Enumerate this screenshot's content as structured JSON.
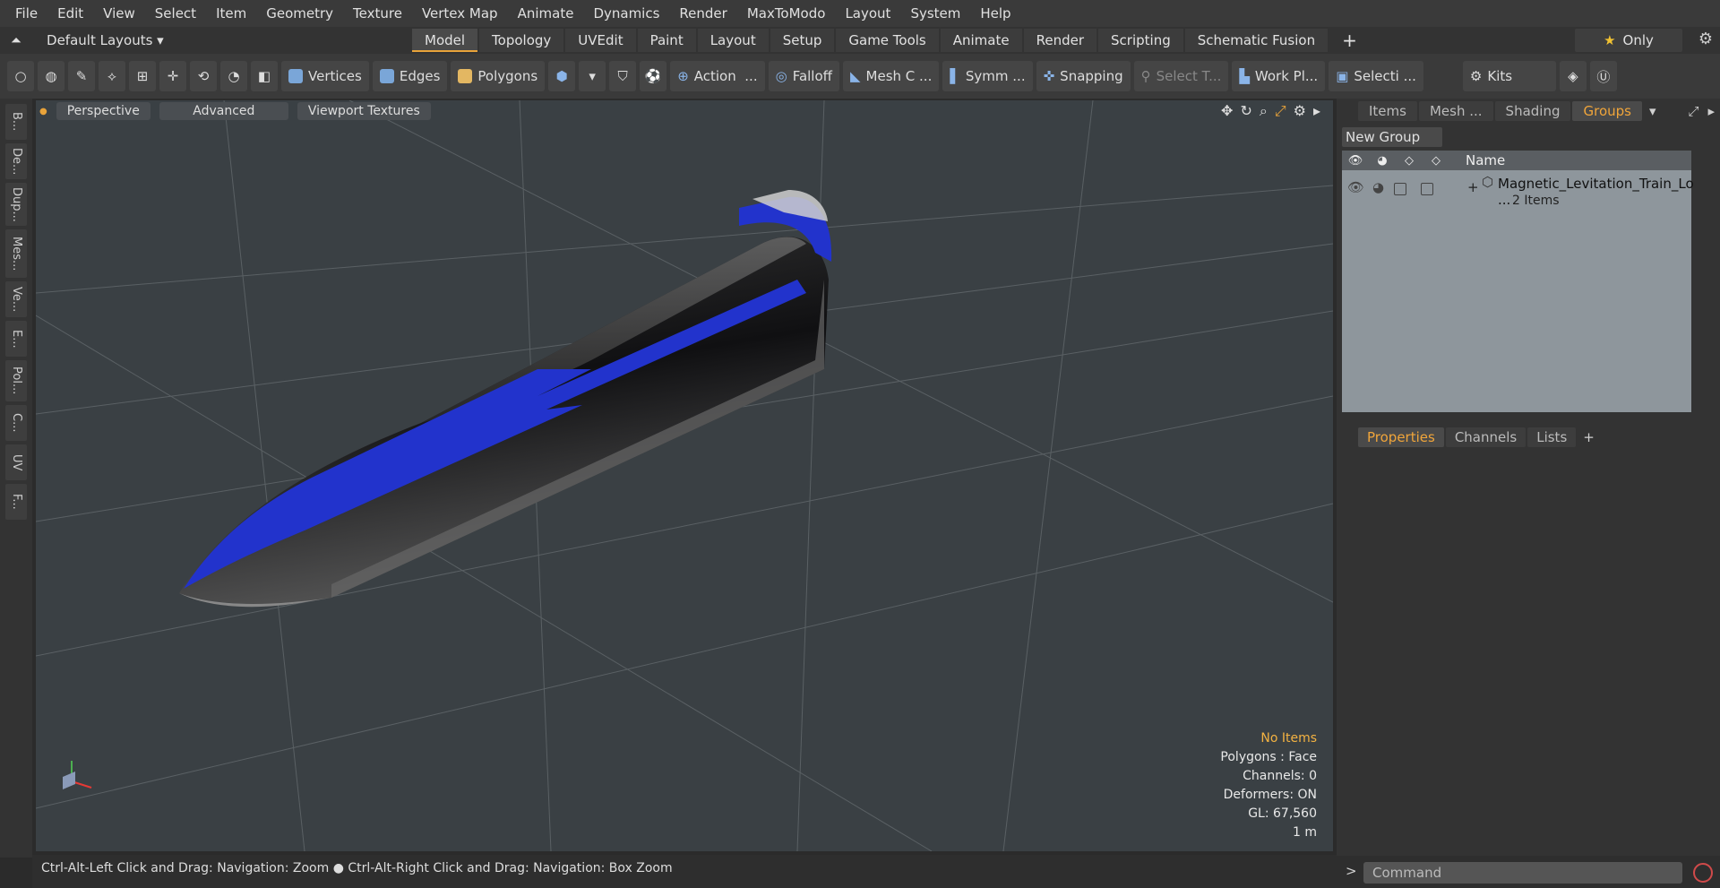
{
  "menu": [
    "File",
    "Edit",
    "View",
    "Select",
    "Item",
    "Geometry",
    "Texture",
    "Vertex Map",
    "Animate",
    "Dynamics",
    "Render",
    "MaxToModo",
    "Layout",
    "System",
    "Help"
  ],
  "layout_dropdown": "Default Layouts",
  "mode_tabs": [
    "Model",
    "Topology",
    "UVEdit",
    "Paint",
    "Layout",
    "Setup",
    "Game Tools",
    "Animate",
    "Render",
    "Scripting",
    "Schematic Fusion"
  ],
  "active_tab": "Model",
  "only_label": "Only",
  "toolbar": {
    "vertices": "Vertices",
    "edges": "Edges",
    "polygons": "Polygons",
    "action": "Action",
    "falloff": "Falloff",
    "mesh": "Mesh C ...",
    "symmetry": "Symm ...",
    "snapping": "Snapping",
    "select_t": "Select T...",
    "work_plane": "Work Pl...",
    "selection": "Selecti ...",
    "kits": "Kits"
  },
  "left_tabs": [
    "B...",
    "De...",
    "Dup...",
    "Mes...",
    "Ve...",
    "E...",
    "Pol...",
    "C...",
    "UV",
    "F..."
  ],
  "viewport": {
    "perspective": "Perspective",
    "advanced": "Advanced",
    "textures": "Viewport Textures",
    "info": {
      "selection": "No Items",
      "polygons": "Polygons : Face",
      "channels": "Channels: 0",
      "deformers": "Deformers: ON",
      "gl": "GL: 67,560",
      "scale": "1 m"
    }
  },
  "status": "Ctrl-Alt-Left Click and Drag: Navigation: Zoom ● Ctrl-Alt-Right Click and Drag: Navigation: Box Zoom",
  "right_tabs": [
    "Items",
    "Mesh ...",
    "Shading",
    "Groups"
  ],
  "active_right_tab": "Groups",
  "new_group": "New Group",
  "groups_header": "Name",
  "group_item": {
    "name": "Magnetic_Levitation_Train_Lo ...",
    "count": "2 Items"
  },
  "props_tabs": [
    "Properties",
    "Channels",
    "Lists"
  ],
  "command_placeholder": "Command"
}
